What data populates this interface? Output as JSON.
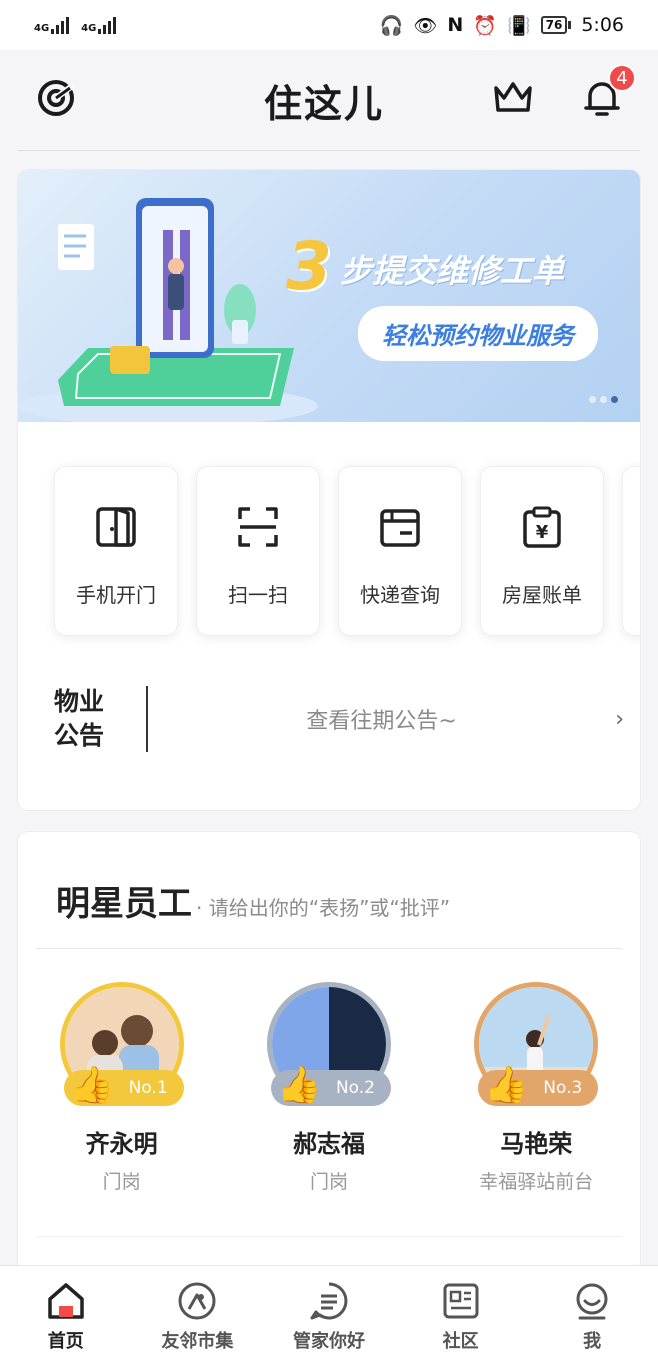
{
  "status_bar": {
    "sim1": "4G",
    "sim2": "4G",
    "battery": "76",
    "time": "5:06"
  },
  "header": {
    "title": "住这儿",
    "notification_count": "4"
  },
  "banner": {
    "number": "3",
    "title": "步提交维修工单",
    "subtitle": "轻松预约物业服务"
  },
  "shortcuts": [
    {
      "label": "手机开门",
      "icon": "door-icon"
    },
    {
      "label": "扫一扫",
      "icon": "scan-icon"
    },
    {
      "label": "快递查询",
      "icon": "package-icon"
    },
    {
      "label": "房屋账单",
      "icon": "bill-icon"
    }
  ],
  "notice": {
    "title_line1": "物业",
    "title_line2": "公告",
    "link": "查看往期公告~"
  },
  "star_employees": {
    "title": "明星员工",
    "subtitle": "· 请给出你的“表扬”或“批评”",
    "items": [
      {
        "rank": "No.1",
        "name": "齐永明",
        "role": "门岗",
        "color": "#f4c83c"
      },
      {
        "rank": "No.2",
        "name": "郝志福",
        "role": "门岗",
        "color": "#a7b2c3"
      },
      {
        "rank": "No.3",
        "name": "马艳荣",
        "role": "幸福驿站前台",
        "color": "#e2a66a"
      }
    ]
  },
  "tabbar": [
    {
      "label": "首页",
      "icon": "home-icon"
    },
    {
      "label": "友邻市集",
      "icon": "market-icon"
    },
    {
      "label": "管家你好",
      "icon": "butler-icon"
    },
    {
      "label": "社区",
      "icon": "community-icon"
    },
    {
      "label": "我",
      "icon": "profile-icon"
    }
  ]
}
